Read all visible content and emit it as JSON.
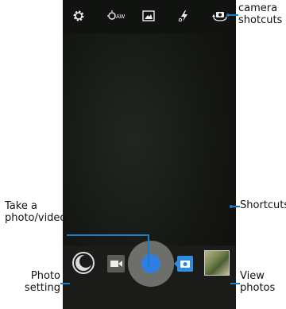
{
  "annotations": {
    "camera_shortcuts": [
      "camera",
      "shotcuts"
    ],
    "shortcuts": "Shortcuts",
    "take_photo": [
      "Take a",
      "photo/video"
    ],
    "photo_setting": [
      "Photo",
      "setting"
    ],
    "view_photos": [
      "View",
      "photos"
    ]
  },
  "top_icons": [
    "gear-icon",
    "white-balance-icon",
    "scene-icon",
    "flash-icon",
    "switch-camera-icon"
  ],
  "bottom_icons": [
    "photo-setting-icon",
    "video-mode-icon",
    "shutter-button",
    "camera-mode-icon",
    "gallery-thumbnail"
  ],
  "top_icon_labels": {
    "white_balance": "AW"
  },
  "colors": {
    "accent": "#1a7cc9",
    "shutter": "#2f7de1",
    "screen_bg": "#151713",
    "bar_bg": "#1b1c1a"
  }
}
